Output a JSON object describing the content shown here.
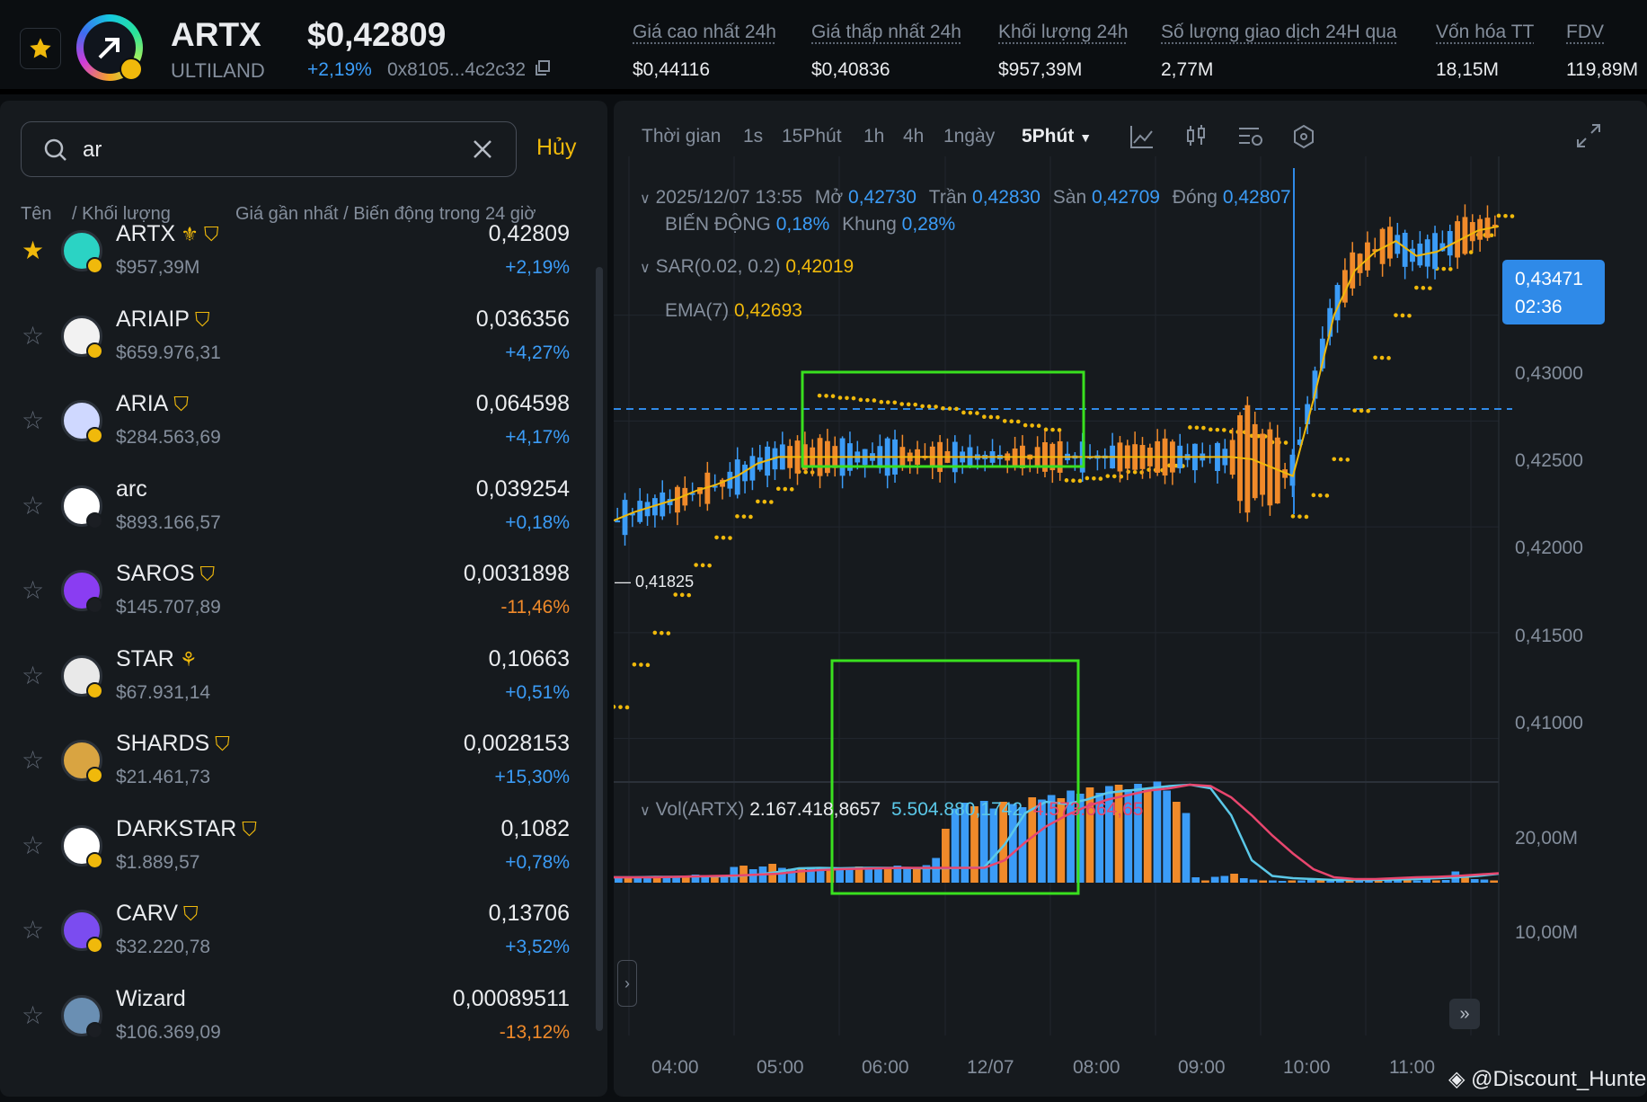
{
  "header": {
    "symbol": "ARTX",
    "project": "ULTILAND",
    "price": "$0,42809",
    "change": "+2,19%",
    "contract": "0x8105...4c2c32",
    "stats": [
      {
        "label": "Giá cao nhất 24h",
        "value": "$0,44116"
      },
      {
        "label": "Giá thấp nhất 24h",
        "value": "$0,40836"
      },
      {
        "label": "Khối lượng 24h",
        "value": "$957,39M"
      },
      {
        "label": "Số lượng giao dịch 24H qua",
        "value": "2,77M"
      },
      {
        "label": "Vốn hóa TT",
        "value": "18,15M"
      },
      {
        "label": "FDV",
        "value": "119,89M"
      }
    ]
  },
  "search": {
    "query": "ar",
    "cancel": "Hủy"
  },
  "list_header": {
    "name": "Tên",
    "volume": "/ Khối lượng",
    "price": "Giá gần nhất / Biến động trong 24 giờ"
  },
  "tokens": [
    {
      "name": "ARTX",
      "volume": "$957,39M",
      "price": "0,42809",
      "change": "+2,19%",
      "dir": "up",
      "fav": true,
      "icon_color": "#2bd3c4",
      "chain_color": "#f0b90b",
      "tag": "alpha-x4"
    },
    {
      "name": "ARIAIP",
      "volume": "$659.976,31",
      "price": "0,036356",
      "change": "+4,27%",
      "dir": "up",
      "fav": false,
      "icon_color": "#f2f2f2",
      "chain_color": "#f0b90b",
      "tag": "alpha"
    },
    {
      "name": "ARIA",
      "volume": "$284.563,69",
      "price": "0,064598",
      "change": "+4,17%",
      "dir": "up",
      "fav": false,
      "icon_color": "#cfd8ff",
      "chain_color": "#f0b90b",
      "tag": "alpha"
    },
    {
      "name": "arc",
      "volume": "$893.166,57",
      "price": "0,039254",
      "change": "+0,18%",
      "dir": "up",
      "fav": false,
      "icon_color": "#ffffff",
      "chain_color": "#1b1e23",
      "tag": ""
    },
    {
      "name": "SAROS",
      "volume": "$145.707,89",
      "price": "0,0031898",
      "change": "-11,46%",
      "dir": "down",
      "fav": false,
      "icon_color": "#8a3df2",
      "chain_color": "#1b1e23",
      "tag": "alpha"
    },
    {
      "name": "STAR",
      "volume": "$67.931,14",
      "price": "0,10663",
      "change": "+0,51%",
      "dir": "up",
      "fav": false,
      "icon_color": "#e9e9e9",
      "chain_color": "#f0b90b",
      "tag": "sprout"
    },
    {
      "name": "SHARDS",
      "volume": "$21.461,73",
      "price": "0,0028153",
      "change": "+15,30%",
      "dir": "up",
      "fav": false,
      "icon_color": "#d9a441",
      "chain_color": "#f0b90b",
      "tag": "alpha"
    },
    {
      "name": "DARKSTAR",
      "volume": "$1.889,57",
      "price": "0,1082",
      "change": "+0,78%",
      "dir": "up",
      "fav": false,
      "icon_color": "#ffffff",
      "chain_color": "#f0b90b",
      "tag": "alpha"
    },
    {
      "name": "CARV",
      "volume": "$32.220,78",
      "price": "0,13706",
      "change": "+3,52%",
      "dir": "up",
      "fav": false,
      "icon_color": "#7b4cf0",
      "chain_color": "#f0b90b",
      "tag": "alpha"
    },
    {
      "name": "Wizard",
      "volume": "$106.369,09",
      "price": "0,00089511",
      "change": "-13,12%",
      "dir": "down",
      "fav": false,
      "icon_color": "#6a8fb3",
      "chain_color": "#1b1e23",
      "tag": ""
    }
  ],
  "toolbar": {
    "time": "Thời gian",
    "intervals": [
      "1s",
      "15Phút",
      "1h",
      "4h",
      "1ngày"
    ],
    "active": "5Phút"
  },
  "ohlc": {
    "date": "2025/12/07 13:55",
    "open_label": "Mở",
    "open": "0,42730",
    "high_label": "Trần",
    "high": "0,42830",
    "low_label": "Sàn",
    "low": "0,42709",
    "close_label": "Đóng",
    "close": "0,42807",
    "change_label": "BIẾN ĐỘNG",
    "change": "0,18%",
    "range_label": "Khung",
    "range": "0,28%"
  },
  "indicators": {
    "sar_label": "SAR(0.02, 0.2)",
    "sar": "0,42019",
    "ema_label": "EMA(7)",
    "ema": "0,42693",
    "vol_label": "Vol(ARTX)",
    "vol": "2.167.418,8657",
    "vol_ma1": "5.504.880,1742",
    "vol_ma2": "4.573.664,65"
  },
  "current_price": {
    "price": "0,43471",
    "countdown": "02:36"
  },
  "low_marker": "0,41825",
  "watermark": "@Discount_Hunter",
  "colors": {
    "up": "#3b9cf7",
    "down": "#f08a2a",
    "sar": "#f0b90b",
    "ema": "#f0b90b",
    "ma1": "#5bc8e8",
    "ma2": "#e8466e",
    "highlight": "#39e01f"
  },
  "chart_data": [
    {
      "type": "candlestick",
      "title": "ARTX 5Phút",
      "y_ticks": [
        "0,43000",
        "0,42500",
        "0,42000",
        "0,41500",
        "0,41000"
      ],
      "x_ticks": [
        "04:00",
        "05:00",
        "06:00",
        "12/07",
        "08:00",
        "09:00",
        "10:00",
        "11:00"
      ],
      "ylim": [
        0.4085,
        0.4375
      ],
      "current_price_line": 0.4281,
      "series": [
        {
          "name": "SAR(0.02, 0.2)",
          "values": [
            0.4115,
            0.4135,
            0.415,
            0.4168,
            0.4182,
            0.4195,
            0.4205,
            0.4212,
            0.4218,
            0.4226,
            0.4262,
            0.4261,
            0.426,
            0.4259,
            0.4258,
            0.4257,
            0.4256,
            0.4254,
            0.4252,
            0.425,
            0.4248,
            0.4246,
            0.4222,
            0.4223,
            0.4224,
            0.4226,
            0.4227,
            0.4229,
            0.4247,
            0.4246,
            0.4245,
            0.4243,
            0.424,
            0.4205,
            0.4215,
            0.4232,
            0.4255,
            0.428,
            0.43,
            0.4313,
            0.4322,
            0.433,
            0.4338,
            0.4347
          ]
        },
        {
          "name": "EMA(7)",
          "values": [
            0.4203,
            0.4207,
            0.421,
            0.4213,
            0.4217,
            0.422,
            0.4224,
            0.423,
            0.4233,
            0.4233,
            0.4233,
            0.4233,
            0.4233,
            0.4233,
            0.4233,
            0.4233,
            0.4233,
            0.4233,
            0.4233,
            0.4233,
            0.4233,
            0.4233,
            0.4233,
            0.4233,
            0.4233,
            0.4233,
            0.4233,
            0.4233,
            0.4233,
            0.4233,
            0.4233,
            0.4232,
            0.4228,
            0.4224,
            0.426,
            0.43,
            0.4321,
            0.433,
            0.4335,
            0.4328,
            0.433,
            0.4335,
            0.434,
            0.4342
          ]
        }
      ]
    },
    {
      "type": "bar",
      "title": "Vol(ARTX)",
      "y_ticks": [
        "20,00M",
        "10,00M"
      ],
      "ylim": [
        0,
        23000000
      ],
      "series": [
        {
          "name": "Vol(ARTX)",
          "values": [
            1.2,
            1.3,
            1.1,
            1.4,
            1.2,
            1.3,
            1.5,
            1.6,
            1.8,
            1.3,
            1.2,
            1.5,
            3.5,
            3.8,
            3.0,
            3.6,
            4.2,
            3.3,
            3.1,
            3.0,
            3.5,
            3.2,
            2.9,
            3.3,
            3.0,
            3.6,
            3.4,
            3.1,
            3.2,
            3.8,
            3.5,
            3.0,
            3.9,
            5.5,
            12.0,
            16.5,
            17.8,
            17.0,
            18.2,
            16.5,
            18.0,
            17.5,
            16.8,
            19.0,
            18.5,
            19.5,
            18.8,
            20.5,
            19.8,
            21.2,
            20.0,
            21.5,
            21.8,
            20.8,
            22.0,
            21.0,
            22.5,
            20.5,
            18.0,
            15.5,
            1.2,
            0.5,
            1.3,
            1.5,
            2.0,
            1.0,
            0.7,
            0.5,
            0.5,
            0.4,
            0.5,
            0.5,
            0.6,
            0.5,
            0.4,
            0.6,
            0.5,
            0.5,
            0.4,
            0.6,
            0.5,
            0.5,
            0.6,
            0.5,
            0.7,
            0.5,
            0.6,
            2.5,
            1.2,
            0.8,
            0.7,
            0.5
          ]
        },
        {
          "name": "MA1",
          "values": [
            1.2,
            1.2,
            1.3,
            1.3,
            1.4,
            1.4,
            1.5,
            1.8,
            2.4,
            3.2,
            3.3,
            3.2,
            3.3,
            3.3,
            3.3,
            3.2,
            3.2,
            3.3,
            3.4,
            8.5,
            15.5,
            18.0,
            17.5,
            18.5,
            20.0,
            20.5,
            21.0,
            21.5,
            21.8,
            21.0,
            15.0,
            5.0,
            1.5,
            1.0,
            0.8,
            0.6,
            0.6,
            0.6,
            0.7,
            0.8,
            1.0,
            1.2,
            1.5,
            2.0
          ]
        },
        {
          "name": "MA2",
          "values": [
            1.2,
            1.2,
            1.2,
            1.3,
            1.4,
            1.5,
            1.6,
            1.8,
            2.0,
            2.5,
            2.8,
            3.0,
            3.1,
            3.2,
            3.3,
            3.3,
            3.3,
            3.3,
            3.3,
            5.0,
            9.0,
            12.5,
            15.0,
            17.0,
            18.5,
            19.5,
            20.5,
            21.0,
            21.8,
            21.5,
            19.0,
            15.0,
            10.5,
            6.5,
            3.0,
            1.2,
            0.8,
            0.8,
            1.0,
            1.2,
            1.3,
            1.5,
            1.8,
            2.1
          ]
        }
      ]
    }
  ]
}
